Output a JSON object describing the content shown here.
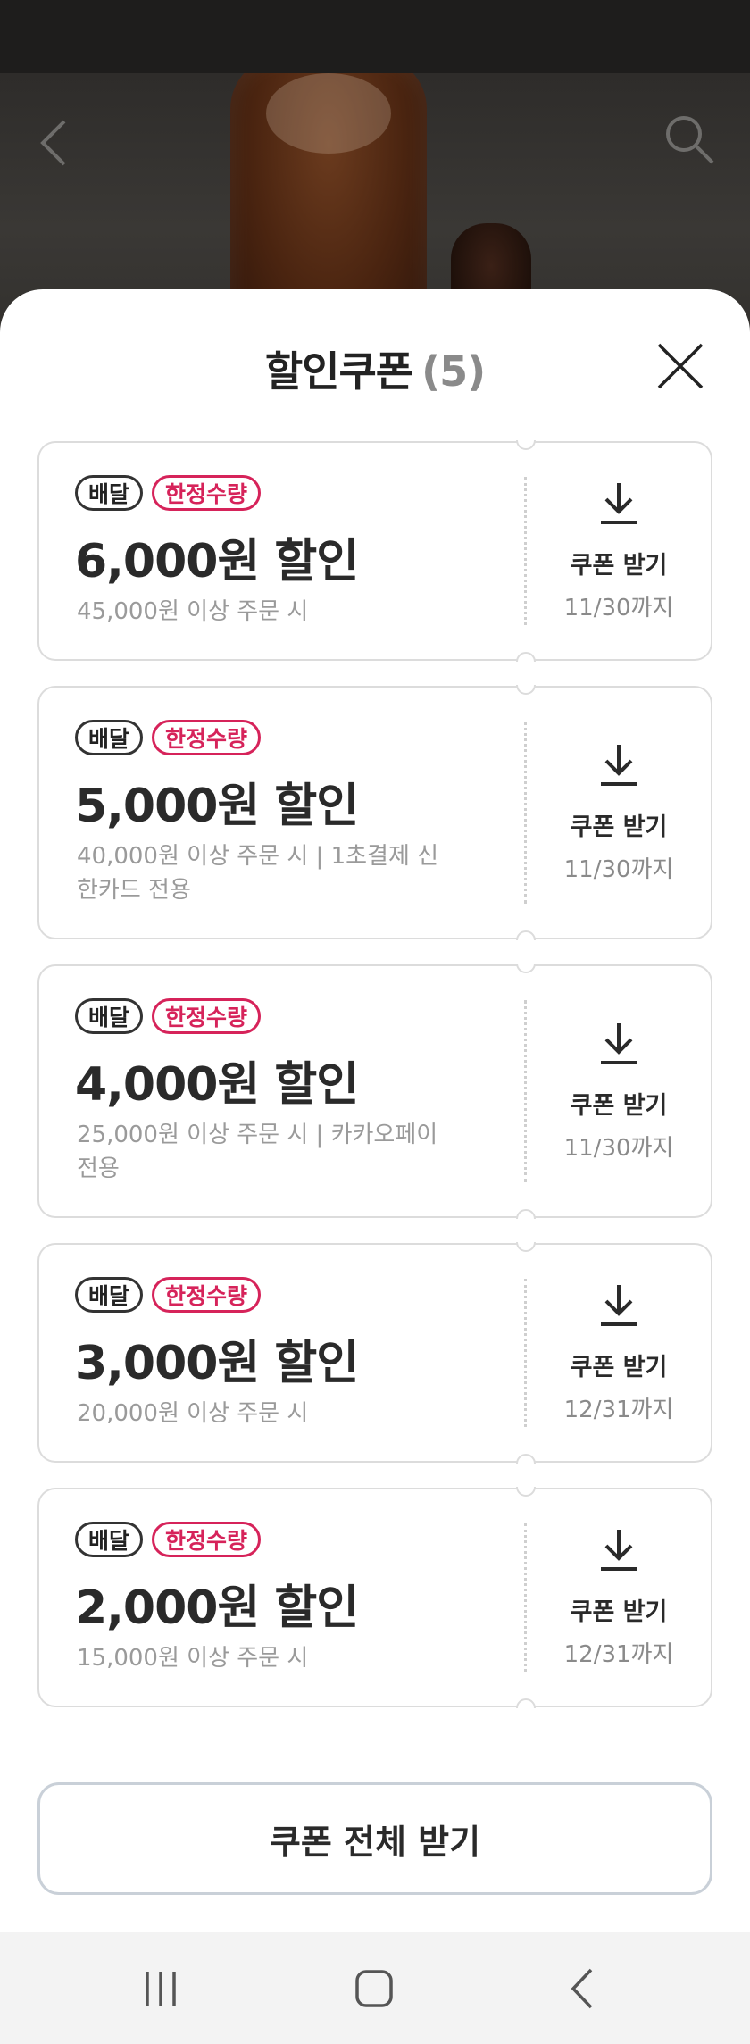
{
  "sheet": {
    "title": "할인쿠폰",
    "count": "(5)"
  },
  "coupons": [
    {
      "badge1": "배달",
      "badge2": "한정수량",
      "amount": "6,000원 할인",
      "condition": "45,000원 이상 주문 시",
      "action": "쿠폰 받기",
      "expiry": "11/30까지"
    },
    {
      "badge1": "배달",
      "badge2": "한정수량",
      "amount": "5,000원 할인",
      "condition": "40,000원 이상 주문 시 | 1초결제 신한카드 전용",
      "action": "쿠폰 받기",
      "expiry": "11/30까지"
    },
    {
      "badge1": "배달",
      "badge2": "한정수량",
      "amount": "4,000원 할인",
      "condition": "25,000원 이상 주문 시 | 카카오페이 전용",
      "action": "쿠폰 받기",
      "expiry": "11/30까지"
    },
    {
      "badge1": "배달",
      "badge2": "한정수량",
      "amount": "3,000원 할인",
      "condition": "20,000원 이상 주문 시",
      "action": "쿠폰 받기",
      "expiry": "12/31까지"
    },
    {
      "badge1": "배달",
      "badge2": "한정수량",
      "amount": "2,000원 할인",
      "condition": "15,000원 이상 주문 시",
      "action": "쿠폰 받기",
      "expiry": "12/31까지"
    }
  ],
  "footer": {
    "all_button": "쿠폰 전체 받기"
  },
  "icons": {
    "back": "chevron-left-icon",
    "search": "search-icon",
    "close": "close-icon",
    "download": "download-icon",
    "nav_recents": "recents-icon",
    "nav_home": "home-icon",
    "nav_back": "back-icon"
  },
  "colors": {
    "accent": "#d6235a",
    "text": "#2a2a2a",
    "muted": "#9a9a9a"
  }
}
